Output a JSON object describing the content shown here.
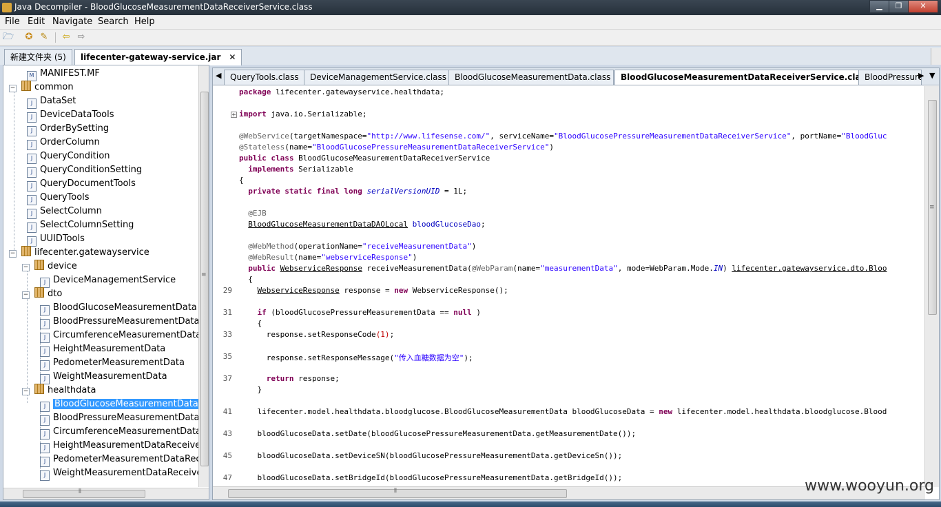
{
  "window": {
    "title": "Java Decompiler - BloodGlucoseMeasurementDataReceiverService.class",
    "buttons": {
      "minimize": "▁",
      "maximize": "❐",
      "close": "✕"
    }
  },
  "menu": [
    "File",
    "Edit",
    "Navigate",
    "Search",
    "Help"
  ],
  "toolbar": {
    "icons": [
      "open-file-icon",
      "open-type-icon",
      "reference-icon",
      "back-arrow-icon",
      "forward-arrow-icon"
    ]
  },
  "outer_tabs": [
    {
      "label": "新建文件夹 (5)",
      "active": false
    },
    {
      "label": "lifecenter-gateway-service.jar",
      "active": true,
      "close": "✕"
    }
  ],
  "tree": [
    {
      "label": "MANIFEST.MF",
      "icon": "M"
    },
    {
      "label": "common",
      "icon": "pkg",
      "exp": "−"
    },
    {
      "label": "DataSet",
      "icon": "J"
    },
    {
      "label": "DeviceDataTools",
      "icon": "J"
    },
    {
      "label": "OrderBySetting",
      "icon": "J"
    },
    {
      "label": "OrderColumn",
      "icon": "J"
    },
    {
      "label": "QueryCondition",
      "icon": "J"
    },
    {
      "label": "QueryConditionSetting",
      "icon": "J"
    },
    {
      "label": "QueryDocumentTools",
      "icon": "J"
    },
    {
      "label": "QueryTools",
      "icon": "J"
    },
    {
      "label": "SelectColumn",
      "icon": "J"
    },
    {
      "label": "SelectColumnSetting",
      "icon": "J"
    },
    {
      "label": "UUIDTools",
      "icon": "J"
    },
    {
      "label": "lifecenter.gatewayservice",
      "icon": "pkg",
      "exp": "−"
    },
    {
      "label": "device",
      "icon": "pkg",
      "exp": "−"
    },
    {
      "label": "DeviceManagementService",
      "icon": "J"
    },
    {
      "label": "dto",
      "icon": "pkg",
      "exp": "−"
    },
    {
      "label": "BloodGlucoseMeasurementData",
      "icon": "J"
    },
    {
      "label": "BloodPressureMeasurementData",
      "icon": "J"
    },
    {
      "label": "CircumferenceMeasurementData",
      "icon": "J"
    },
    {
      "label": "HeightMeasurementData",
      "icon": "J"
    },
    {
      "label": "PedometerMeasurementData",
      "icon": "J"
    },
    {
      "label": "WeightMeasurementData",
      "icon": "J"
    },
    {
      "label": "healthdata",
      "icon": "pkg",
      "exp": "−"
    },
    {
      "label": "BloodGlucoseMeasurementDataR",
      "icon": "J",
      "selected": true
    },
    {
      "label": "BloodPressureMeasurementDataR",
      "icon": "J"
    },
    {
      "label": "CircumferenceMeasurementDataR",
      "icon": "J"
    },
    {
      "label": "HeightMeasurementDataReceiverS",
      "icon": "J"
    },
    {
      "label": "PedometerMeasurementDataRece",
      "icon": "J"
    },
    {
      "label": "WeightMeasurementDataReceiver",
      "icon": "J"
    }
  ],
  "editor_tabs": [
    {
      "label": "QueryTools.class",
      "active": false
    },
    {
      "label": "DeviceManagementService.class",
      "active": false
    },
    {
      "label": "BloodGlucoseMeasurementData.class",
      "active": false
    },
    {
      "label": "BloodGlucoseMeasurementDataReceiverService.class",
      "active": true,
      "close": "✕"
    },
    {
      "label": "BloodPressure",
      "active": false
    }
  ],
  "tab_nav": {
    "left": "◀",
    "right": "▶",
    "menu": "▼"
  },
  "code": [
    {
      "ln": "",
      "segs": [
        [
          "kw",
          "package"
        ],
        [
          "",
          "lifecenter.gatewayservice.healthdata;"
        ]
      ]
    },
    {
      "ln": "",
      "fold": "+",
      "segs": [
        [
          "kw",
          "import"
        ],
        [
          "",
          "java.io.Serializable;"
        ]
      ]
    },
    {
      "ln": "",
      "segs": [
        [
          "ann",
          "@WebService"
        ],
        [
          "",
          "(targetNamespace="
        ],
        [
          "str",
          "\"http://www.lifesense.com/\""
        ],
        [
          "",
          ", serviceName="
        ],
        [
          "str",
          "\"BloodGlucosePressureMeasurementDataReceiverService\""
        ],
        [
          "",
          ", portName="
        ],
        [
          "str",
          "\"BloodGluc"
        ]
      ]
    },
    {
      "ln": "",
      "segs": [
        [
          "ann",
          "@Stateless"
        ],
        [
          "",
          "(name="
        ],
        [
          "str",
          "\"BloodGlucosePressureMeasurementDataReceiverService\""
        ],
        [
          "",
          ")"
        ]
      ]
    },
    {
      "ln": "",
      "segs": [
        [
          "kw",
          "public class"
        ],
        [
          "",
          " BloodGlucoseMeasurementDataReceiverService"
        ]
      ]
    },
    {
      "ln": "",
      "segs": [
        [
          "",
          "  "
        ],
        [
          "kw",
          "implements"
        ],
        [
          "",
          " Serializable"
        ]
      ]
    },
    {
      "ln": "",
      "segs": [
        [
          "",
          "{"
        ]
      ]
    },
    {
      "ln": "",
      "segs": [
        [
          "",
          "  "
        ],
        [
          "kw",
          "private static final long"
        ],
        [
          "",
          " "
        ],
        [
          "fld",
          "serialVersionUID"
        ],
        [
          "",
          " = 1L;"
        ]
      ]
    },
    {
      "ln": "",
      "segs": [
        [
          "",
          "  "
        ],
        [
          "ann",
          "@EJB"
        ]
      ]
    },
    {
      "ln": "",
      "segs": [
        [
          "",
          "  "
        ],
        [
          "u",
          "BloodGlucoseMeasurementDataDAOLocal"
        ],
        [
          "",
          " "
        ],
        [
          "fld2",
          "bloodGlucoseDao"
        ],
        [
          "",
          ";"
        ]
      ]
    },
    {
      "ln": "",
      "segs": [
        [
          "",
          "  "
        ],
        [
          "ann",
          "@WebMethod"
        ],
        [
          "",
          "(operationName="
        ],
        [
          "str",
          "\"receiveMeasurementData\""
        ],
        [
          "",
          ")"
        ]
      ]
    },
    {
      "ln": "",
      "segs": [
        [
          "",
          "  "
        ],
        [
          "ann",
          "@WebResult"
        ],
        [
          "",
          "(name="
        ],
        [
          "str",
          "\"webserviceResponse\""
        ],
        [
          "",
          ")"
        ]
      ]
    },
    {
      "ln": "",
      "segs": [
        [
          "",
          "  "
        ],
        [
          "kw",
          "public"
        ],
        [
          "",
          " "
        ],
        [
          "u",
          "WebserviceResponse"
        ],
        [
          "",
          " receiveMeasurementData("
        ],
        [
          "ann",
          "@WebParam"
        ],
        [
          "",
          "(name="
        ],
        [
          "str",
          "\"measurementData\""
        ],
        [
          "",
          ", mode=WebParam.Mode."
        ],
        [
          "fld",
          "IN"
        ],
        [
          "",
          ") "
        ],
        [
          "u",
          "lifecenter.gatewayservice.dto.Bloo"
        ]
      ]
    },
    {
      "ln": "",
      "segs": [
        [
          "",
          "  {"
        ]
      ]
    },
    {
      "ln": "29",
      "segs": [
        [
          "",
          "    "
        ],
        [
          "u",
          "WebserviceResponse"
        ],
        [
          "",
          " response = "
        ],
        [
          "kw",
          "new"
        ],
        [
          "",
          " WebserviceResponse();"
        ]
      ]
    },
    {
      "ln": "31",
      "segs": [
        [
          "",
          "    "
        ],
        [
          "kw",
          "if"
        ],
        [
          "",
          " (bloodGlucosePressureMeasurementData == "
        ],
        [
          "kw",
          "null"
        ],
        [
          "",
          ")"
        ]
      ]
    },
    {
      "ln": "",
      "segs": [
        [
          "",
          "    {"
        ]
      ]
    },
    {
      "ln": "33",
      "segs": [
        [
          "",
          "      response.setResponseCode"
        ],
        [
          "red",
          "(1)"
        ],
        [
          "",
          ";"
        ]
      ]
    },
    {
      "ln": "35",
      "segs": [
        [
          "",
          "      response.setResponseMessage("
        ],
        [
          "str",
          "\"传入血糖数据为空\""
        ],
        [
          "",
          ");"
        ]
      ]
    },
    {
      "ln": "37",
      "segs": [
        [
          "",
          "      "
        ],
        [
          "kw",
          "return"
        ],
        [
          "",
          " response;"
        ]
      ]
    },
    {
      "ln": "",
      "segs": [
        [
          "",
          "    }"
        ]
      ]
    },
    {
      "ln": "41",
      "segs": [
        [
          "",
          "    lifecenter.model.healthdata.bloodglucose.BloodGlucoseMeasurementData bloodGlucoseData = "
        ],
        [
          "kw",
          "new"
        ],
        [
          "",
          " lifecenter.model.healthdata.bloodglucose.Blood"
        ]
      ]
    },
    {
      "ln": "43",
      "segs": [
        [
          "",
          "    bloodGlucoseData.setDate(bloodGlucosePressureMeasurementData.getMeasurementDate());"
        ]
      ]
    },
    {
      "ln": "45",
      "segs": [
        [
          "",
          "    bloodGlucoseData.setDeviceSN(bloodGlucosePressureMeasurementData.getDeviceSn());"
        ]
      ]
    },
    {
      "ln": "47",
      "segs": [
        [
          "",
          "    bloodGlucoseData.setBridgeId(bloodGlucosePressureMeasurementData.getBridgeId());"
        ]
      ]
    }
  ],
  "scroll_grip": "≡",
  "hscroll_grip": "⦀",
  "watermark": "www.wooyun.org"
}
